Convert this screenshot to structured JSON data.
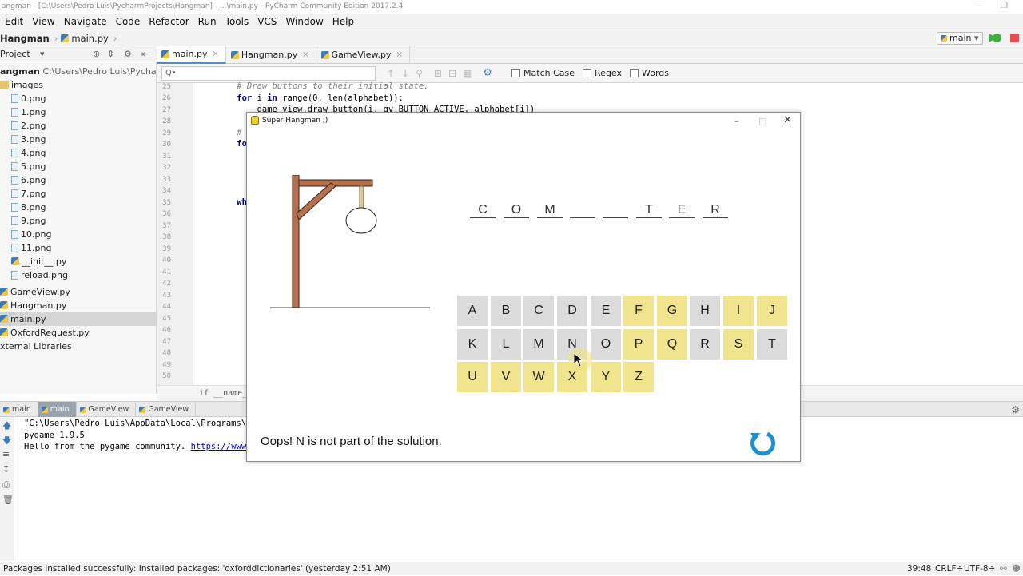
{
  "window_title": "angman - [C:\\Users\\Pedro Luis\\PycharmProjects\\Hangman] - ...\\main.py - PyCharm Community Edition 2017.2.4",
  "menu": [
    "Edit",
    "View",
    "Navigate",
    "Code",
    "Refactor",
    "Run",
    "Tools",
    "VCS",
    "Window",
    "Help"
  ],
  "nav": {
    "project": "Hangman",
    "file": "main.py",
    "run_config": "main"
  },
  "project_panel": {
    "label": "Project",
    "root": "angman",
    "root_path": "C:\\Users\\Pedro Luis\\PycharmProje",
    "items": [
      "images",
      "0.png",
      "1.png",
      "2.png",
      "3.png",
      "4.png",
      "5.png",
      "6.png",
      "7.png",
      "8.png",
      "9.png",
      "10.png",
      "11.png",
      "__init__.py",
      "reload.png",
      "GameView.py",
      "Hangman.py",
      "main.py",
      "OxfordRequest.py",
      "xternal Libraries"
    ]
  },
  "editor_tabs": [
    "main.py",
    "Hangman.py",
    "GameView.py"
  ],
  "find": {
    "placeholder": "Q•",
    "options": [
      "Match Case",
      "Regex",
      "Words"
    ]
  },
  "line_numbers": [
    "25",
    "26",
    "27",
    "28",
    "29",
    "30",
    "31",
    "32",
    "33",
    "34",
    "35",
    "36",
    "37",
    "38",
    "39",
    "40",
    "41",
    "42",
    "43",
    "44",
    "45",
    "46",
    "47",
    "48",
    "49",
    "50"
  ],
  "code_lines": {
    "l25": "    # Draw buttons to their initial state.",
    "l26a": "    for",
    "l26b": " i ",
    "l26c": "in",
    "l26d": " range(0, len(alphabet)):",
    "l27": "        game_view.draw_button(i, gv.BUTTON_ACTIVE, alphabet[i])",
    "l29": "    #",
    "l30": "    fo",
    "l35": "    wh"
  },
  "crumb": "if __name__ ==",
  "run_tabs": [
    "main",
    "main",
    "GameView",
    "GameView"
  ],
  "console": {
    "line1": "\"C:\\Users\\Pedro Luis\\AppData\\Local\\Programs\\P",
    "line2": "pygame 1.9.5",
    "line3": "Hello from the pygame community. ",
    "link": "https://www."
  },
  "status": {
    "message": "Packages installed successfully: Installed packages: 'oxforddictionaries' (yesterday 2:51 AM)",
    "position": "39:48",
    "line_sep": "CRLF÷",
    "encoding": "UTF-8÷"
  },
  "game": {
    "title": "Super Hangman ;)",
    "word": [
      "C",
      "O",
      "M",
      "",
      "",
      "T",
      "E",
      "R"
    ],
    "message": "Oops! N is not part of the solution.",
    "keys": [
      {
        "l": "A",
        "s": "active"
      },
      {
        "l": "B",
        "s": "active"
      },
      {
        "l": "C",
        "s": "active"
      },
      {
        "l": "D",
        "s": "active"
      },
      {
        "l": "E",
        "s": "active"
      },
      {
        "l": "F",
        "s": "used"
      },
      {
        "l": "G",
        "s": "used"
      },
      {
        "l": "H",
        "s": "active"
      },
      {
        "l": "I",
        "s": "used"
      },
      {
        "l": "J",
        "s": "used"
      },
      {
        "l": "K",
        "s": "active"
      },
      {
        "l": "L",
        "s": "active"
      },
      {
        "l": "M",
        "s": "active"
      },
      {
        "l": "N",
        "s": "active"
      },
      {
        "l": "O",
        "s": "active"
      },
      {
        "l": "P",
        "s": "used"
      },
      {
        "l": "Q",
        "s": "used"
      },
      {
        "l": "R",
        "s": "active"
      },
      {
        "l": "S",
        "s": "used"
      },
      {
        "l": "T",
        "s": "active"
      },
      {
        "l": "U",
        "s": "used"
      },
      {
        "l": "V",
        "s": "used"
      },
      {
        "l": "W",
        "s": "used"
      },
      {
        "l": "X",
        "s": "used"
      },
      {
        "l": "Y",
        "s": "used"
      },
      {
        "l": "Z",
        "s": "used"
      }
    ],
    "colors": {
      "active": "#dcdcdc",
      "used": "#f0e58e",
      "gallows": "#b5714e",
      "reload": "#1a8fd1"
    }
  }
}
